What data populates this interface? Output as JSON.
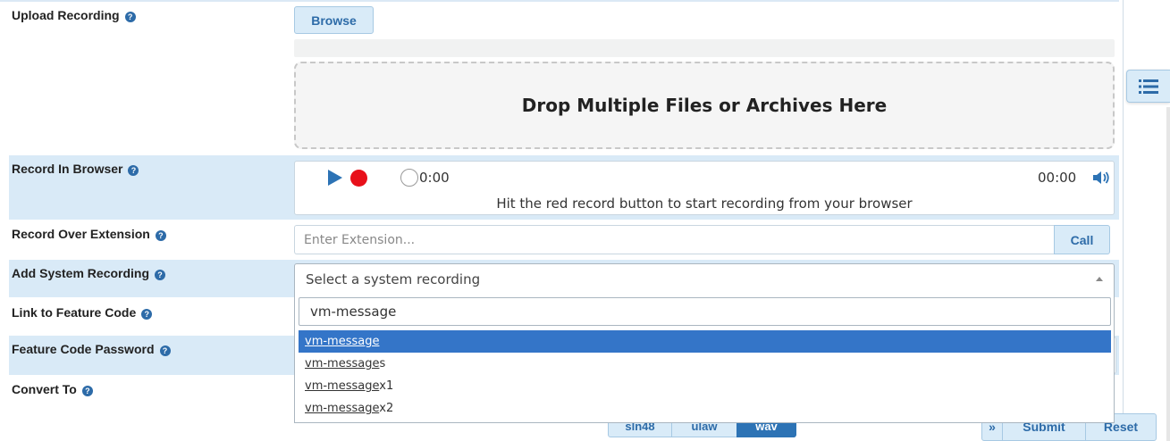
{
  "upload": {
    "label": "Upload Recording",
    "browse_label": "Browse",
    "dropzone_text": "Drop Multiple Files or Archives Here"
  },
  "record_browser": {
    "label": "Record In Browser",
    "current_time": "0:00",
    "total_time": "00:00",
    "hint": "Hit the red record button to start recording from your browser"
  },
  "record_extension": {
    "label": "Record Over Extension",
    "placeholder": "Enter Extension...",
    "call_label": "Call"
  },
  "system_recording": {
    "label": "Add System Recording",
    "select_placeholder": "Select a system recording",
    "search_value": "vm-message",
    "options": [
      {
        "match": "vm-message",
        "rest": "",
        "selected": true
      },
      {
        "match": "vm-message",
        "rest": "s",
        "selected": false
      },
      {
        "match": "vm-message",
        "rest": "x1",
        "selected": false
      },
      {
        "match": "vm-message",
        "rest": "x2",
        "selected": false
      }
    ]
  },
  "feature_code": {
    "label": "Link to Feature Code"
  },
  "feature_password": {
    "label": "Feature Code Password"
  },
  "convert": {
    "label": "Convert To",
    "formats": [
      "sln48",
      "ulaw",
      "wav"
    ],
    "active_format": "wav"
  },
  "footer": {
    "expand_glyph": "»",
    "submit_label": "Submit",
    "reset_label": "Reset"
  },
  "colors": {
    "row_alt": "#d9eaf7",
    "accent": "#2d6ba8",
    "selected_option": "#3475c8",
    "record_red": "#e8101a"
  },
  "icons": {
    "help": "question-circle-icon",
    "play": "play-icon",
    "record": "record-icon",
    "volume": "volume-icon",
    "side_toggle": "list-icon",
    "caret": "caret-up-icon"
  }
}
